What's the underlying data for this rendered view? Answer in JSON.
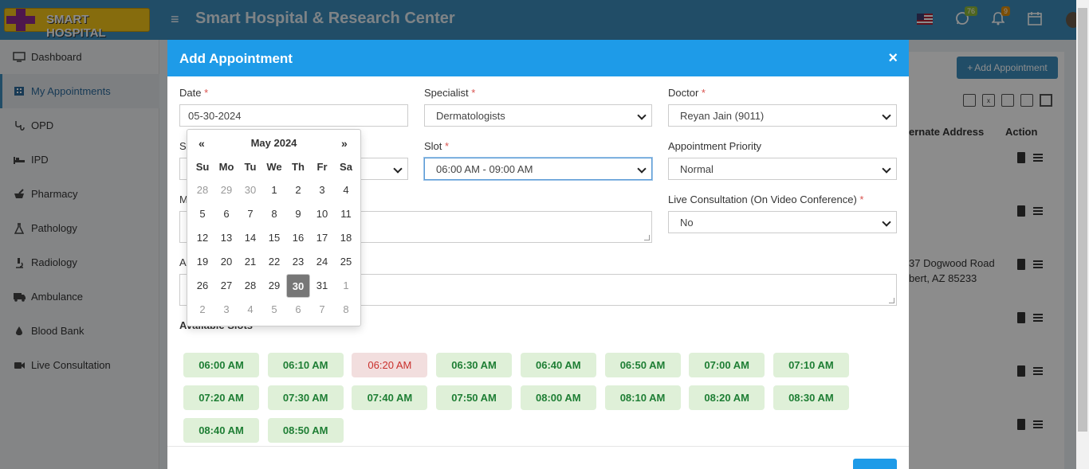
{
  "app": {
    "logo_text": "SMART HOSPITAL",
    "title": "Smart Hospital & Research Center"
  },
  "topbar": {
    "whatsapp_count": "76",
    "notification_count": "9"
  },
  "sidebar": {
    "items": [
      {
        "label": "Dashboard",
        "icon": "monitor-icon"
      },
      {
        "label": "My Appointments",
        "icon": "hospital-icon"
      },
      {
        "label": "OPD",
        "icon": "stethoscope-icon"
      },
      {
        "label": "IPD",
        "icon": "bed-icon"
      },
      {
        "label": "Pharmacy",
        "icon": "mortar-pestle-icon"
      },
      {
        "label": "Pathology",
        "icon": "flask-icon"
      },
      {
        "label": "Radiology",
        "icon": "microscope-icon"
      },
      {
        "label": "Ambulance",
        "icon": "ambulance-icon"
      },
      {
        "label": "Blood Bank",
        "icon": "tint-icon"
      },
      {
        "label": "Live Consultation",
        "icon": "video-icon"
      }
    ]
  },
  "background": {
    "add_appointment": "Add Appointment",
    "col_alternate_address": "ernate Address",
    "col_action": "Action",
    "address_line1": "37 Dogwood Road",
    "address_line2": "bert, AZ 85233"
  },
  "modal": {
    "title": "Add Appointment",
    "close": "×",
    "date_label": "Date",
    "date_value": "05-30-2024",
    "specialist_label": "Specialist",
    "specialist_value": "Dermatologists",
    "doctor_label": "Doctor",
    "doctor_value": "Reyan Jain (9011)",
    "shift_label_partial": "S",
    "message_label_partial": "M",
    "address_label_partial": "A",
    "slot_label": "Slot",
    "slot_value": "06:00 AM - 09:00 AM",
    "priority_label": "Appointment Priority",
    "priority_value": "Normal",
    "live_label": "Live Consultation (On Video Conference)",
    "live_value": "No",
    "available_slots_label": "Available Slots",
    "required_mark": "*"
  },
  "calendar": {
    "prev": "«",
    "next": "»",
    "month_year": "May 2024",
    "weekdays": [
      "Su",
      "Mo",
      "Tu",
      "We",
      "Th",
      "Fr",
      "Sa"
    ],
    "weeks": [
      [
        "28",
        "29",
        "30",
        "1",
        "2",
        "3",
        "4"
      ],
      [
        "5",
        "6",
        "7",
        "8",
        "9",
        "10",
        "11"
      ],
      [
        "12",
        "13",
        "14",
        "15",
        "16",
        "17",
        "18"
      ],
      [
        "19",
        "20",
        "21",
        "22",
        "23",
        "24",
        "25"
      ],
      [
        "26",
        "27",
        "28",
        "29",
        "30",
        "31",
        "1"
      ],
      [
        "2",
        "3",
        "4",
        "5",
        "6",
        "7",
        "8"
      ]
    ],
    "selected_day": "30"
  },
  "slots": [
    {
      "time": "06:00 AM",
      "available": true
    },
    {
      "time": "06:10 AM",
      "available": true
    },
    {
      "time": "06:20 AM",
      "available": false
    },
    {
      "time": "06:30 AM",
      "available": true
    },
    {
      "time": "06:40 AM",
      "available": true
    },
    {
      "time": "06:50 AM",
      "available": true
    },
    {
      "time": "07:00 AM",
      "available": true
    },
    {
      "time": "07:10 AM",
      "available": true
    },
    {
      "time": "07:20 AM",
      "available": true
    },
    {
      "time": "07:30 AM",
      "available": true
    },
    {
      "time": "07:40 AM",
      "available": true
    },
    {
      "time": "07:50 AM",
      "available": true
    },
    {
      "time": "08:00 AM",
      "available": true
    },
    {
      "time": "08:10 AM",
      "available": true
    },
    {
      "time": "08:20 AM",
      "available": true
    },
    {
      "time": "08:30 AM",
      "available": true
    },
    {
      "time": "08:40 AM",
      "available": true
    },
    {
      "time": "08:50 AM",
      "available": true
    }
  ],
  "colors": {
    "header": "#3c8dbc",
    "modal_header": "#1e9be8",
    "slot_available": "#dff0d8",
    "slot_booked": "#f2dede",
    "logo": "#f5c518"
  }
}
